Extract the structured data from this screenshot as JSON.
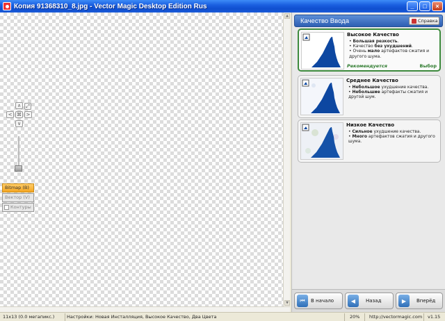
{
  "window": {
    "title": "Копия 91368310_8.jpg - Vector Magic Desktop Edition Rus",
    "buttons": {
      "minimize": "_",
      "maximize": "□",
      "close": "×"
    }
  },
  "tools": {
    "nav": {
      "up": "∧",
      "down": "∨",
      "left": "<",
      "right": ">",
      "center": "⌘"
    },
    "mode_bitmap": "Bitmap (B)",
    "mode_vector": "Вектор (V)",
    "mode_contours": "Контуры"
  },
  "panel": {
    "title": "Качество Ввода",
    "help_label": "Справка",
    "cards": [
      {
        "title": "Высокое Качество",
        "bullets": [
          {
            "bold": "Большая резкость",
            "text": "."
          },
          {
            "pre": "Качество ",
            "bold": "без ухудшений",
            "text": "."
          },
          {
            "pre": "Очень ",
            "bold": "мало",
            "text": " артефактов сжатия и другого шума."
          }
        ],
        "footer": "Рекомендуется",
        "action": "Выбор",
        "selected": true
      },
      {
        "title": "Среднее Качество",
        "bullets": [
          {
            "bold": "Небольшое",
            "text": " ухудшение качества."
          },
          {
            "bold": "Небольшие",
            "text": " артефакты сжатия и другой шум."
          }
        ],
        "selected": false
      },
      {
        "title": "Низкое Качество",
        "bullets": [
          {
            "bold": "Сильное",
            "text": " ухудшение качества."
          },
          {
            "bold": "Много",
            "text": " артефактов сжатия и другого шума."
          }
        ],
        "selected": false
      }
    ],
    "nav": {
      "home": "В начало",
      "back": "Назад",
      "next": "Вперёд"
    }
  },
  "status": {
    "size": "11x13 (0.0 мегапикс.)",
    "settings": "Настройки: Новая Инсталляция, Высокое Качество, Два Цвета",
    "zoom": "20%",
    "url": "http://vectormagic.com",
    "version": "v1.15"
  },
  "colors": {
    "accent": "#2d5fb3",
    "selected_border": "#3d8a3d",
    "bitmap_button": "#f5a623",
    "shape": "#0d47a1"
  }
}
